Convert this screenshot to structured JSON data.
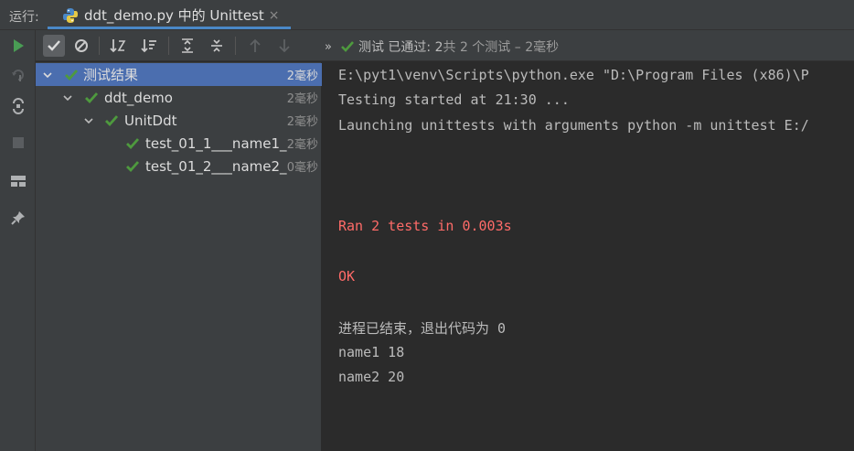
{
  "run_tab": {
    "run_label": "运行:",
    "tab_title": "ddt_demo.py 中的 Unittest",
    "close_glyph": "×"
  },
  "toolbar": {
    "status_chevron": "»",
    "status_main": "测试 已通过: 2",
    "status_sub": "共 2 个测试 – 2毫秒"
  },
  "tree": {
    "items": [
      {
        "label": "测试结果",
        "time": "2毫秒",
        "selected": true
      },
      {
        "label": "ddt_demo",
        "time": "2毫秒"
      },
      {
        "label": "UnitDdt",
        "time": "2毫秒"
      },
      {
        "label": "test_01_1___name1_",
        "time": "2毫秒"
      },
      {
        "label": "test_01_2___name2_",
        "time": "0毫秒"
      }
    ]
  },
  "console": {
    "lines": [
      {
        "text": "E:\\pyt1\\venv\\Scripts\\python.exe \"D:\\Program Files (x86)\\P",
        "style": "normal"
      },
      {
        "text": "Testing started at 21:30 ...",
        "style": "normal"
      },
      {
        "text": "Launching unittests with arguments python -m unittest E:/",
        "style": "normal"
      },
      {
        "text": "Ran 2 tests in 0.003s",
        "style": "error"
      },
      {
        "text": "OK",
        "style": "error"
      },
      {
        "text": "进程已结束，退出代码为 0",
        "style": "normal"
      },
      {
        "text": "name1 18",
        "style": "normal"
      },
      {
        "text": "name2 20",
        "style": "normal"
      }
    ]
  },
  "colors": {
    "pass_green": "#4e9a3e",
    "accent_blue": "#4a88c7",
    "selection": "#4b6eaf",
    "error_red": "#ff6b68"
  }
}
